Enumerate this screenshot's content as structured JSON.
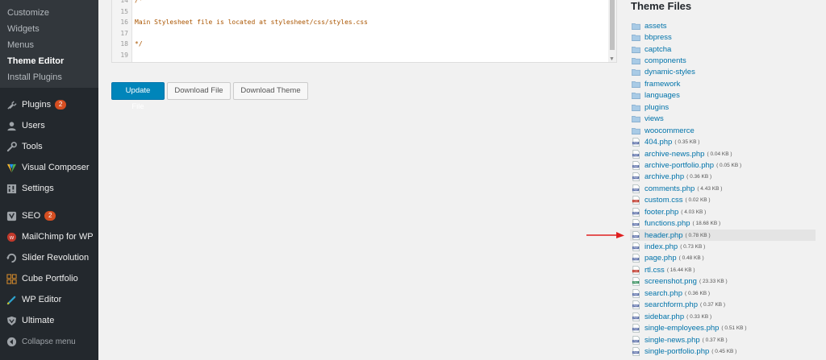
{
  "sidebar": {
    "submenu": [
      {
        "label": "Customize",
        "current": false
      },
      {
        "label": "Widgets",
        "current": false
      },
      {
        "label": "Menus",
        "current": false
      },
      {
        "label": "Theme Editor",
        "current": true
      },
      {
        "label": "Install Plugins",
        "current": false
      }
    ],
    "menu": [
      {
        "label": "Plugins",
        "icon": "plugin-icon",
        "badge": "2"
      },
      {
        "label": "Users",
        "icon": "users-icon"
      },
      {
        "label": "Tools",
        "icon": "tools-icon"
      },
      {
        "label": "Visual Composer",
        "icon": "visual-composer-icon"
      },
      {
        "label": "Settings",
        "icon": "settings-icon"
      },
      {
        "label": "SEO",
        "icon": "seo-icon",
        "badge": "2"
      },
      {
        "label": "MailChimp for WP",
        "icon": "mailchimp-icon"
      },
      {
        "label": "Slider Revolution",
        "icon": "slider-revolution-icon"
      },
      {
        "label": "Cube Portfolio",
        "icon": "cube-portfolio-icon"
      },
      {
        "label": "WP Editor",
        "icon": "wp-editor-icon"
      },
      {
        "label": "Ultimate",
        "icon": "ultimate-icon"
      }
    ],
    "collapse_label": "Collapse menu"
  },
  "editor": {
    "lines": [
      {
        "num": "14",
        "text": "/*"
      },
      {
        "num": "15",
        "text": ""
      },
      {
        "num": "16",
        "text": "Main Stylesheet file is located at stylesheet/css/styles.css"
      },
      {
        "num": "17",
        "text": ""
      },
      {
        "num": "18",
        "text": "*/"
      },
      {
        "num": "19",
        "text": ""
      }
    ]
  },
  "buttons": {
    "update": "Update File",
    "download_file": "Download File",
    "download_theme": "Download Theme"
  },
  "theme_files": {
    "title": "Theme Files",
    "folders": [
      "assets",
      "bbpress",
      "captcha",
      "components",
      "dynamic-styles",
      "framework",
      "languages",
      "plugins",
      "views",
      "woocommerce"
    ],
    "files": [
      {
        "name": "404.php",
        "size": "( 0.35 KB )",
        "type": "php"
      },
      {
        "name": "archive-news.php",
        "size": "( 0.04 KB )",
        "type": "php"
      },
      {
        "name": "archive-portfolio.php",
        "size": "( 0.05 KB )",
        "type": "php"
      },
      {
        "name": "archive.php",
        "size": "( 0.36 KB )",
        "type": "php"
      },
      {
        "name": "comments.php",
        "size": "( 4.43 KB )",
        "type": "php"
      },
      {
        "name": "custom.css",
        "size": "( 0.02 KB )",
        "type": "css"
      },
      {
        "name": "footer.php",
        "size": "( 4.03 KB )",
        "type": "php"
      },
      {
        "name": "functions.php",
        "size": "( 18.68 KB )",
        "type": "php"
      },
      {
        "name": "header.php",
        "size": "( 0.78 KB )",
        "type": "php",
        "highlight": true
      },
      {
        "name": "index.php",
        "size": "( 0.73 KB )",
        "type": "php"
      },
      {
        "name": "page.php",
        "size": "( 0.48 KB )",
        "type": "php"
      },
      {
        "name": "rtl.css",
        "size": "( 16.44 KB )",
        "type": "css"
      },
      {
        "name": "screenshot.png",
        "size": "( 23.33 KB )",
        "type": "png"
      },
      {
        "name": "search.php",
        "size": "( 0.36 KB )",
        "type": "php"
      },
      {
        "name": "searchform.php",
        "size": "( 0.37 KB )",
        "type": "php"
      },
      {
        "name": "sidebar.php",
        "size": "( 0.33 KB )",
        "type": "php"
      },
      {
        "name": "single-employees.php",
        "size": "( 0.51 KB )",
        "type": "php"
      },
      {
        "name": "single-news.php",
        "size": "( 0.37 KB )",
        "type": "php"
      },
      {
        "name": "single-portfolio.php",
        "size": "( 0.45 KB )",
        "type": "php"
      }
    ]
  },
  "colors": {
    "sidebar_bg": "#23282d",
    "primary": "#0085ba",
    "link": "#0073aa",
    "badge": "#d54e21",
    "arrow": "#e02020"
  }
}
